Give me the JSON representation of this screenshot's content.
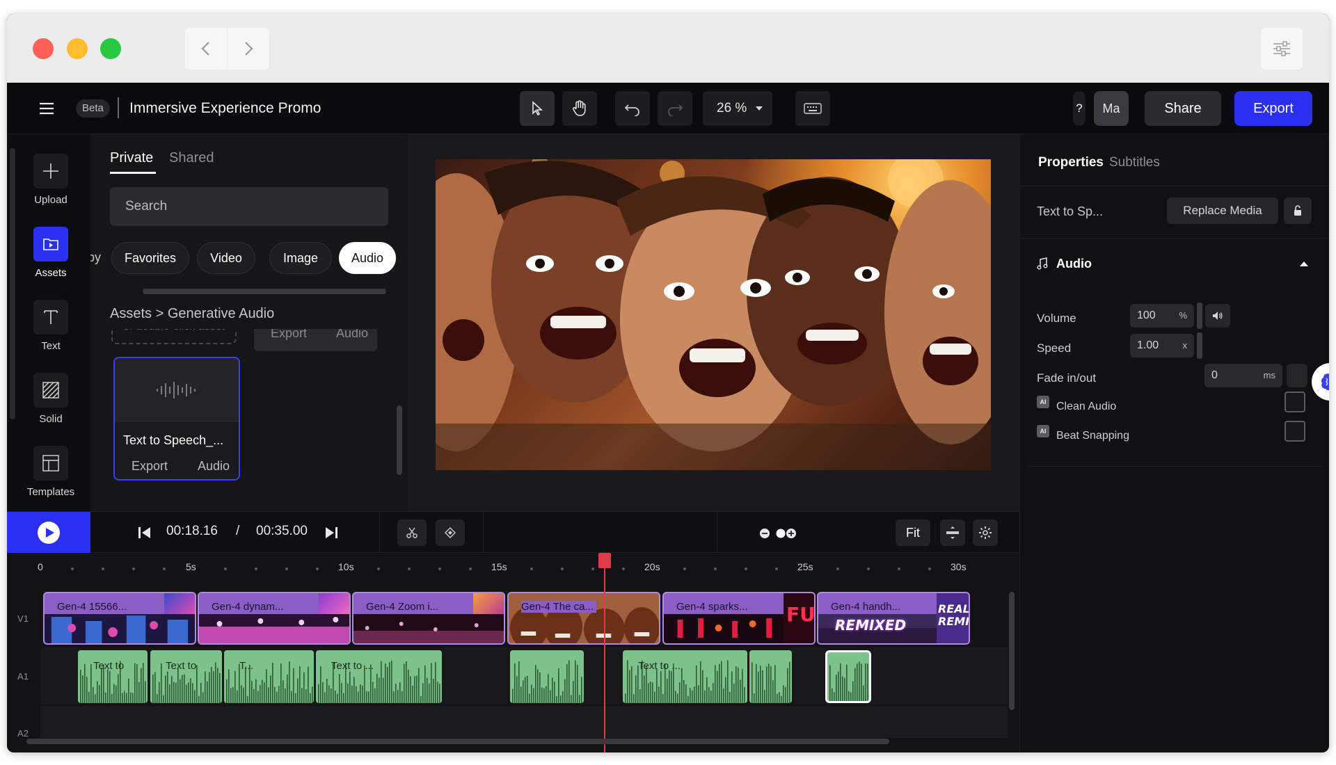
{
  "app": {
    "beta_label": "Beta",
    "project_title": "Immersive Experience Promo",
    "zoom": "26 %",
    "avatar_initials": "Ma",
    "help_glyph": "?",
    "share_label": "Share",
    "export_label": "Export"
  },
  "rail": {
    "items": [
      {
        "label": "Upload",
        "icon": "plus-icon"
      },
      {
        "label": "Assets",
        "icon": "folder-play-icon"
      },
      {
        "label": "Text",
        "icon": "text-icon"
      },
      {
        "label": "Solid",
        "icon": "solid-icon"
      },
      {
        "label": "Templates",
        "icon": "template-icon"
      }
    ]
  },
  "assets": {
    "tabs": [
      "Private",
      "Shared"
    ],
    "search_placeholder": "Search",
    "chip_clipped": "by",
    "chips": [
      "Favorites",
      "Video",
      "Image",
      "Audio"
    ],
    "active_chip": "Audio",
    "breadcrumb": "Assets > Generative Audio",
    "ghost_text": "or double-click asset",
    "ghost_export": "Export",
    "ghost_type": "Audio",
    "card": {
      "title": "Text to Speech_...",
      "action": "Export",
      "type": "Audio"
    }
  },
  "properties": {
    "tabs": [
      "Properties",
      "Subtitles"
    ],
    "media_name": "Text to Sp...",
    "replace_label": "Replace Media",
    "section": "Audio",
    "volume_label": "Volume",
    "volume_value": "100",
    "volume_unit": "%",
    "speed_label": "Speed",
    "speed_value": "1.00",
    "speed_unit": "x",
    "fade_label": "Fade in/out",
    "fade_value": "0",
    "fade_unit": "ms",
    "ai_badge": "AI",
    "clean_audio": "Clean Audio",
    "beat_snapping": "Beat Snapping"
  },
  "transport": {
    "current_time": "00:18.16",
    "separator": "/",
    "total_time": "00:35.00",
    "fit_label": "Fit"
  },
  "timeline": {
    "ticks": [
      "0",
      "5s",
      "10s",
      "15s",
      "20s",
      "25s",
      "30s"
    ],
    "tracks": [
      "V1",
      "A1",
      "A2"
    ],
    "video_clips": [
      "Gen-4 15566...",
      "Gen-4 dynam...",
      "Gen-4 Zoom i...",
      "Gen-4 The ca...",
      "Gen-4 sparks...",
      "Gen-4 handh..."
    ],
    "audio_clips": [
      "Text to",
      "Text to",
      "T...",
      "Text to ...",
      "",
      "Text to ...",
      "",
      ""
    ],
    "thumb_texts": [
      "FU",
      "REMIXED",
      "REALI REMIX"
    ]
  }
}
